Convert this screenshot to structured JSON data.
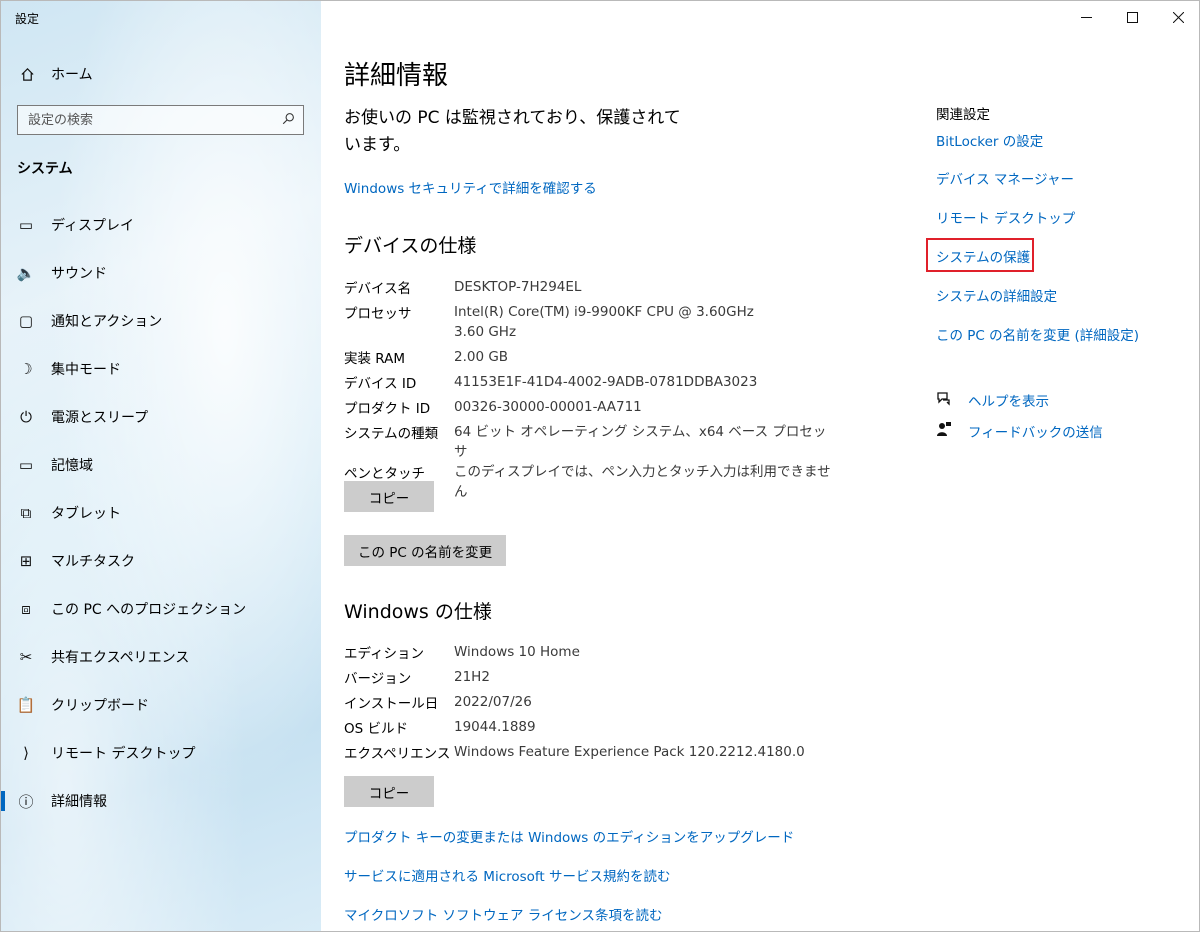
{
  "window": {
    "title": "設定",
    "minimize_glyph": "—",
    "maximize_glyph": "☐",
    "close_glyph": "✕"
  },
  "sidebar": {
    "home_label": "ホーム",
    "search_placeholder": "設定の検索",
    "section_title": "システム",
    "items": [
      {
        "label": "ディスプレイ",
        "icon": "monitor-icon",
        "glyph": "▭"
      },
      {
        "label": "サウンド",
        "icon": "speaker-icon",
        "glyph": "🔈"
      },
      {
        "label": "通知とアクション",
        "icon": "notification-icon",
        "glyph": "▢"
      },
      {
        "label": "集中モード",
        "icon": "moon-icon",
        "glyph": "☽"
      },
      {
        "label": "電源とスリープ",
        "icon": "power-icon",
        "glyph": "⏻"
      },
      {
        "label": "記憶域",
        "icon": "storage-icon",
        "glyph": "▭"
      },
      {
        "label": "タブレット",
        "icon": "tablet-icon",
        "glyph": "⧉"
      },
      {
        "label": "マルチタスク",
        "icon": "multitask-icon",
        "glyph": "⊞"
      },
      {
        "label": "この PC へのプロジェクション",
        "icon": "projection-icon",
        "glyph": "⧈"
      },
      {
        "label": "共有エクスペリエンス",
        "icon": "share-icon",
        "glyph": "✂"
      },
      {
        "label": "クリップボード",
        "icon": "clipboard-icon",
        "glyph": "📋"
      },
      {
        "label": "リモート デスクトップ",
        "icon": "remote-icon",
        "glyph": "⟩"
      },
      {
        "label": "詳細情報",
        "icon": "info-icon",
        "glyph": "ⓘ",
        "active": true
      }
    ]
  },
  "main": {
    "title": "詳細情報",
    "status_text": "お使いの PC は監視されており、保護されています。",
    "security_link": "Windows セキュリティで詳細を確認する",
    "device_specs": {
      "heading": "デバイスの仕様",
      "rows": [
        {
          "key": "デバイス名",
          "value": "DESKTOP-7H294EL"
        },
        {
          "key": "プロセッサ",
          "value": "Intel(R) Core(TM) i9-9900KF CPU @ 3.60GHz   3.60 GHz"
        },
        {
          "key": "実装 RAM",
          "value": "2.00 GB"
        },
        {
          "key": "デバイス ID",
          "value": "41153E1F-41D4-4002-9ADB-0781DDBA3023"
        },
        {
          "key": "プロダクト ID",
          "value": "00326-30000-00001-AA711"
        },
        {
          "key": "システムの種類",
          "value": "64 ビット オペレーティング システム、x64 ベース プロセッサ"
        },
        {
          "key": "ペンとタッチ",
          "value": "このディスプレイでは、ペン入力とタッチ入力は利用できません"
        }
      ],
      "copy_label": "コピー",
      "rename_label": "この PC の名前を変更"
    },
    "windows_specs": {
      "heading": "Windows の仕様",
      "rows": [
        {
          "key": "エディション",
          "value": "Windows 10 Home"
        },
        {
          "key": "バージョン",
          "value": "21H2"
        },
        {
          "key": "インストール日",
          "value": "2022/07/26"
        },
        {
          "key": "OS ビルド",
          "value": "19044.1889"
        },
        {
          "key": "エクスペリエンス",
          "value": "Windows Feature Experience Pack 120.2212.4180.0"
        }
      ],
      "copy_label": "コピー"
    },
    "bottom_links": [
      "プロダクト キーの変更または Windows のエディションをアップグレード",
      "サービスに適用される Microsoft サービス規約を読む",
      "マイクロソフト ソフトウェア ライセンス条項を読む"
    ]
  },
  "related": {
    "title": "関連設定",
    "links": [
      "BitLocker の設定",
      "デバイス マネージャー",
      "リモート デスクトップ",
      "システムの保護",
      "システムの詳細設定",
      "この PC の名前を変更 (詳細設定)"
    ],
    "help_label": "ヘルプを表示",
    "feedback_label": "フィードバックの送信"
  },
  "colors": {
    "accent": "#0067c0",
    "highlight": "#e0202a",
    "button": "#cccccc"
  }
}
